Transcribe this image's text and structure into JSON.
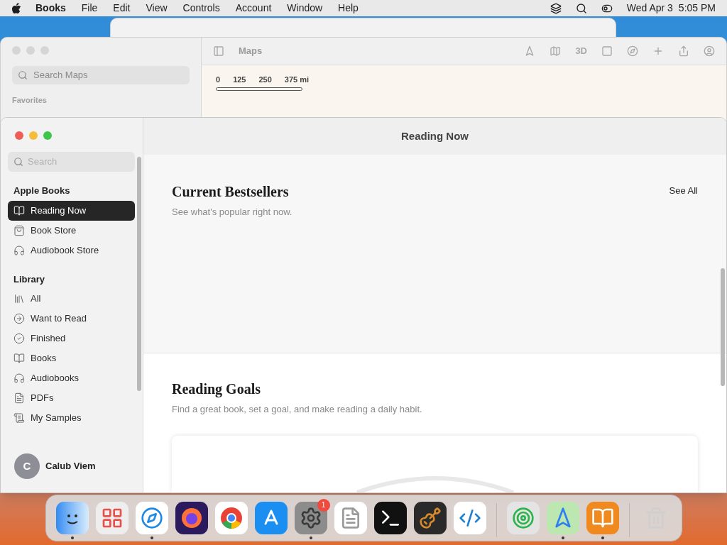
{
  "menu_bar": {
    "app_name": "Books",
    "menus": [
      "File",
      "Edit",
      "View",
      "Controls",
      "Account",
      "Window",
      "Help"
    ],
    "date": "Wed Apr 3",
    "time": "5:05 PM"
  },
  "maps_window": {
    "title": "Maps",
    "search": {
      "placeholder": "Search Maps"
    },
    "section": "Favorites",
    "toolbar_label": "3D",
    "scale": [
      "0",
      "125",
      "250",
      "375 mi"
    ]
  },
  "books_window": {
    "title": "Reading Now",
    "search": {
      "placeholder": "Search"
    },
    "sidebar": [
      {
        "heading": "Apple Books",
        "items": [
          {
            "label": "Reading Now",
            "selected": true
          },
          {
            "label": "Book Store",
            "selected": false
          },
          {
            "label": "Audiobook Store",
            "selected": false
          }
        ]
      },
      {
        "heading": "Library",
        "items": [
          {
            "label": "All",
            "selected": false
          },
          {
            "label": "Want to Read",
            "selected": false
          },
          {
            "label": "Finished",
            "selected": false
          },
          {
            "label": "Books",
            "selected": false
          },
          {
            "label": "Audiobooks",
            "selected": false
          },
          {
            "label": "PDFs",
            "selected": false
          },
          {
            "label": "My Samples",
            "selected": false
          }
        ]
      }
    ],
    "account": {
      "initial": "C",
      "name": "Calub Viem"
    },
    "sections": [
      {
        "title": "Current Bestsellers",
        "subtitle": "See what's popular right now.",
        "link": "See All",
        "kind": "shelf"
      },
      {
        "title": "Reading Goals",
        "subtitle": "Find a great book, set a goal, and make reading a daily habit.",
        "kind": "goal"
      }
    ]
  },
  "dock": [
    {
      "kind": "finder",
      "running": true
    },
    {
      "kind": "launchpad",
      "running": false
    },
    {
      "kind": "safari",
      "running": true
    },
    {
      "kind": "firefox",
      "running": false
    },
    {
      "kind": "chrome",
      "running": false
    },
    {
      "kind": "appstore",
      "running": false
    },
    {
      "kind": "settings",
      "running": true,
      "badge": "1"
    },
    {
      "kind": "textedit",
      "running": false
    },
    {
      "kind": "terminal",
      "running": false
    },
    {
      "kind": "garageband",
      "running": false
    },
    {
      "kind": "vscode",
      "running": false
    },
    {
      "kind": "separator"
    },
    {
      "kind": "findmy",
      "running": false
    },
    {
      "kind": "maps",
      "running": true
    },
    {
      "kind": "books",
      "running": true
    },
    {
      "kind": "separator"
    },
    {
      "kind": "trash",
      "running": false
    }
  ]
}
